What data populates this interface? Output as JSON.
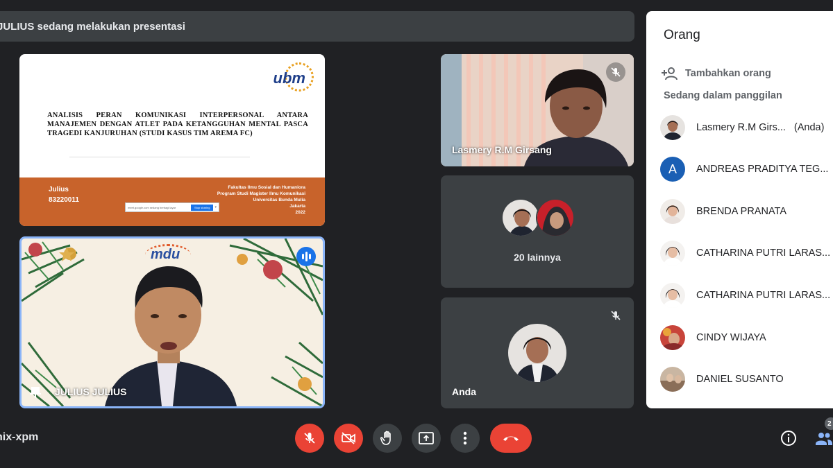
{
  "banner": {
    "text": "JULIUS sedang melakukan presentasi"
  },
  "slide": {
    "logo_text": "ubm",
    "title": "ANALISIS PERAN KOMUNIKASI INTERPERSONAL ANTARA MANAJEMEN DENGAN ATLET PADA KETANGGUHAN MENTAL PASCA TRAGEDI KANJURUHAN (STUDI KASUS TIM AREMA FC)",
    "author_name": "Julius",
    "author_id": "83220011",
    "institution": [
      "Fakultas Ilmu Sosial dan Humaniora",
      "Program Studi Magister Ilmu Komunikasi",
      "Universitas Bunda Mulia",
      "Jakarta",
      "2022"
    ],
    "share_bar_button": "Stop sharing"
  },
  "tiles": {
    "presenter": {
      "name": "JULIUS JULIUS",
      "logo_text": "mdu"
    },
    "lasmery": {
      "name": "Lasmery R.M Girsang"
    },
    "others": {
      "label": "20 lainnya"
    },
    "self": {
      "name": "Anda"
    }
  },
  "panel": {
    "title": "Orang",
    "add_label": "Tambahkan orang",
    "section_label": "Sedang dalam panggilan",
    "people": [
      {
        "name": "Lasmery R.M Girs...",
        "you": "(Anda)",
        "avatar": "photo"
      },
      {
        "name": "ANDREAS PRADITYA TEG...",
        "avatar": "initial",
        "initial": "A",
        "color": "#1a5fb4"
      },
      {
        "name": "BRENDA PRANATA",
        "avatar": "photo"
      },
      {
        "name": "CATHARINA PUTRI LARAS...",
        "avatar": "photo"
      },
      {
        "name": "CATHARINA PUTRI LARAS...",
        "avatar": "photo"
      },
      {
        "name": "CINDY WIJAYA",
        "avatar": "photo"
      },
      {
        "name": "DANIEL SUSANTO",
        "avatar": "photo"
      }
    ]
  },
  "bottom_bar": {
    "meeting_code": "nix-xpm",
    "participant_count": "2"
  },
  "colors": {
    "accent_blue": "#1a73e8",
    "danger_red": "#ea4335",
    "slide_footer": "#c8632b"
  }
}
